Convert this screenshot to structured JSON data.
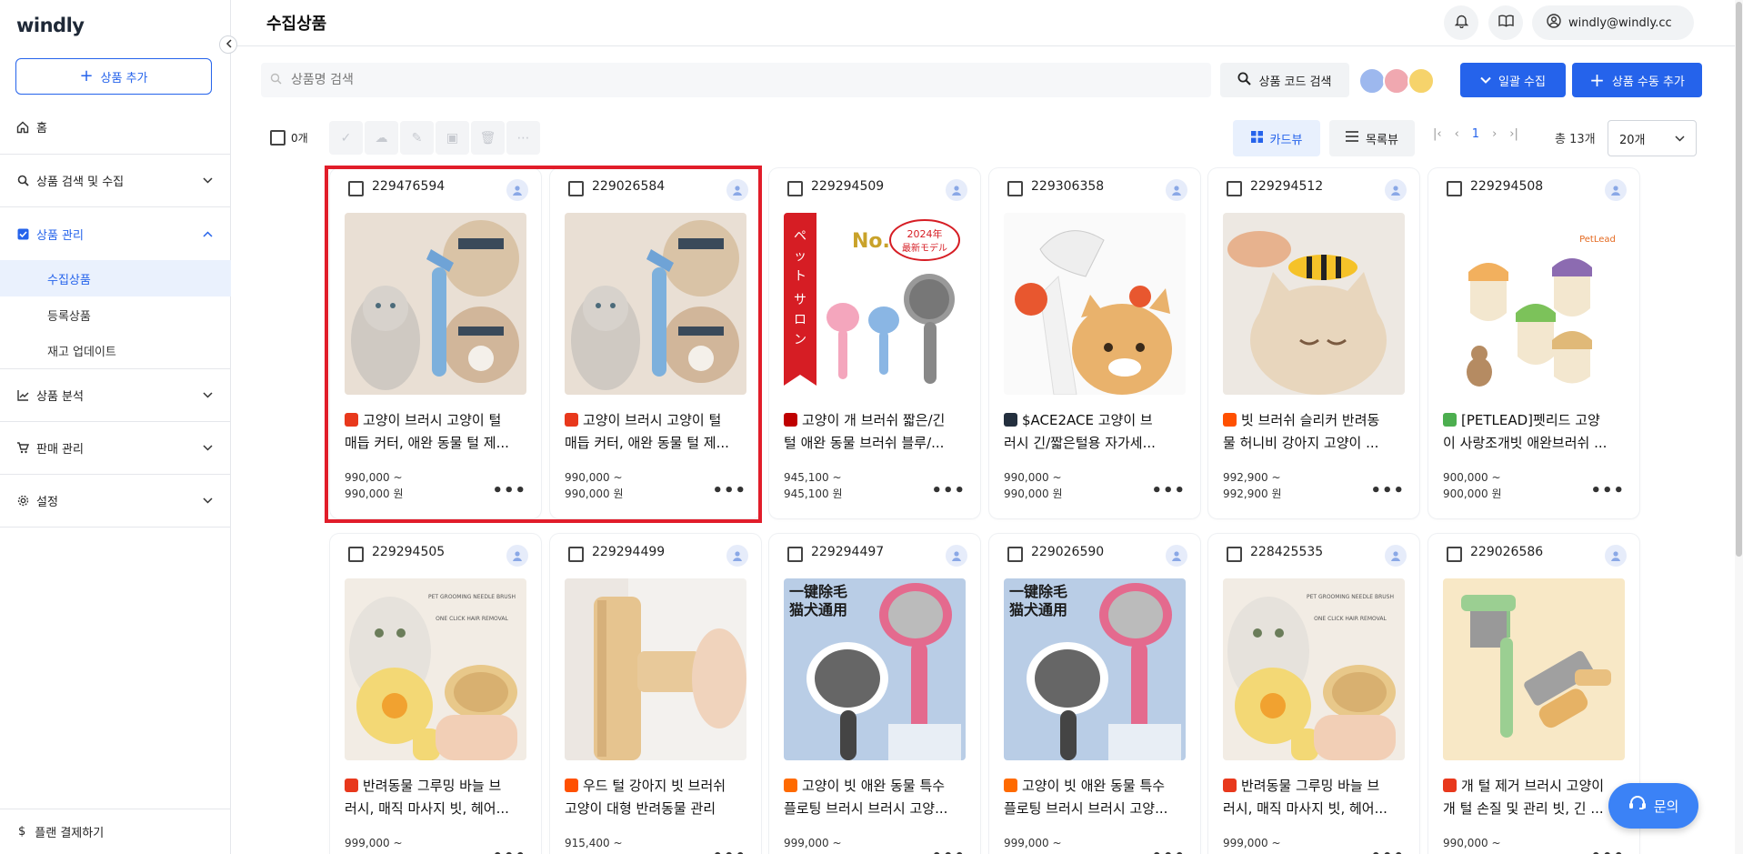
{
  "app": {
    "logo": "windly"
  },
  "sidebar": {
    "add_button": "상품 추가",
    "home": "홈",
    "sections": [
      {
        "label": "상품 검색 및 수집",
        "icon": "search-icon"
      },
      {
        "label": "상품 관리",
        "icon": "checkbox-icon"
      },
      {
        "label": "상품 분석",
        "icon": "chart-icon"
      },
      {
        "label": "판매 관리",
        "icon": "cart-icon"
      },
      {
        "label": "설정",
        "icon": "gear-icon"
      }
    ],
    "sub_items": [
      "수집상품",
      "등록상품",
      "재고 업데이트"
    ],
    "plan": "플랜 결제하기"
  },
  "header": {
    "title": "수집상품",
    "user": "windly@windly.cc"
  },
  "search": {
    "placeholder": "상품명 검색",
    "code_search": "상품 코드 검색",
    "bulk_collect": "일괄 수집",
    "manual_add": "상품 수동 추가"
  },
  "toolbar": {
    "selected_count": "0개",
    "card_view": "카드뷰",
    "list_view": "목록뷰",
    "page": "1",
    "total": "총 13개",
    "per_page": "20개"
  },
  "colors": {
    "accent": "#2563eb",
    "highlight": "#e11d2a"
  },
  "products": [
    {
      "id": "229476594",
      "title_line1": "고양이 브러시 고양이 털",
      "title_line2": "매듭 커터, 애완 동물 털 제...",
      "price1": "990,000 ~",
      "price2": "990,000 원",
      "source": "aliexpress",
      "image": "blue-dematting-brush-cat"
    },
    {
      "id": "229026584",
      "title_line1": "고양이 브러시 고양이 털",
      "title_line2": "매듭 커터, 애완 동물 털 제...",
      "price1": "990,000 ~",
      "price2": "990,000 원",
      "source": "aliexpress",
      "image": "blue-dematting-brush-cat"
    },
    {
      "id": "229294509",
      "title_line1": "고양이 개 브러쉬 짧은/긴",
      "title_line2": "털 애완 동물 브러쉬 블루/...",
      "price1": "945,100 ~",
      "price2": "945,100 원",
      "source": "rakuten",
      "image": "slicker-brushes-set"
    },
    {
      "id": "229306358",
      "title_line1": "$ACE2ACE 고양이 브",
      "title_line2": "러시 긴/짧은털용 자가세...",
      "price1": "990,000 ~",
      "price2": "990,000 원",
      "source": "amazon",
      "image": "white-self-cleaning-brush"
    },
    {
      "id": "229294512",
      "title_line1": "빗 브러쉬 슬리커 반려동",
      "title_line2": "물 허니비 강아지 고양이 ...",
      "price1": "992,900 ~",
      "price2": "992,900 원",
      "source": "taobao",
      "image": "bee-brush-cat"
    },
    {
      "id": "229294508",
      "title_line1": "[PETLEAD]펫리드 고양",
      "title_line2": "이 사랑조개빗 애완브러쉬 ...",
      "price1": "900,000 ~",
      "price2": "900,000 원",
      "source": "coupang",
      "image": "shell-combs"
    },
    {
      "id": "229294505",
      "title_line1": "반려동물 그루밍 바늘 브",
      "title_line2": "러시, 매직 마사지 빗, 헤어...",
      "price1": "999,000 ~",
      "price2": "",
      "source": "aliexpress",
      "image": "yellow-round-brush-cat",
      "img_text1": "PET GROOMING NEEDLE BRUSH",
      "img_text2": "ONE CLICK HAIR REMOVAL"
    },
    {
      "id": "229294499",
      "title_line1": "우드 털 강아지 빗 브러쉬",
      "title_line2": "고양이 대형 반려동물 관리",
      "price1": "915,400 ~",
      "price2": "",
      "source": "taobao",
      "image": "wooden-brush"
    },
    {
      "id": "229294497",
      "title_line1": "고양이 빗 애완 동물 특수",
      "title_line2": "플로팅 브러시 브러시 고양...",
      "price1": "999,000 ~",
      "price2": "",
      "source": "1688",
      "image": "pink-brush-blue",
      "img_text1": "一键除毛",
      "img_text2": "猫犬通用"
    },
    {
      "id": "229026590",
      "title_line1": "고양이 빗 애완 동물 특수",
      "title_line2": "플로팅 브러시 브러시 고양...",
      "price1": "999,000 ~",
      "price2": "",
      "source": "1688",
      "image": "pink-brush-blue",
      "img_text1": "一键除毛",
      "img_text2": "猫犬通用"
    },
    {
      "id": "228425535",
      "title_line1": "반려동물 그루밍 바늘 브",
      "title_line2": "러시, 매직 마사지 빗, 헤어...",
      "price1": "999,000 ~",
      "price2": "",
      "source": "aliexpress",
      "image": "yellow-round-brush-cat",
      "img_text1": "PET GROOMING NEEDLE BRUSH",
      "img_text2": "ONE CLICK HAIR REMOVAL"
    },
    {
      "id": "229026586",
      "title_line1": "개 털 제거 브러시 고양이",
      "title_line2": "개 털 손질 및 관리 빗, 긴 ...",
      "price1": "990,000 ~",
      "price2": "",
      "source": "aliexpress",
      "image": "green-rake-brush"
    }
  ],
  "product_image_text": {
    "no1": "No.1",
    "year": "2024年",
    "model": "最新モデル",
    "salon": "ペットサロン推薦",
    "petlead": "PetLead"
  },
  "chat": {
    "label": "문의"
  }
}
